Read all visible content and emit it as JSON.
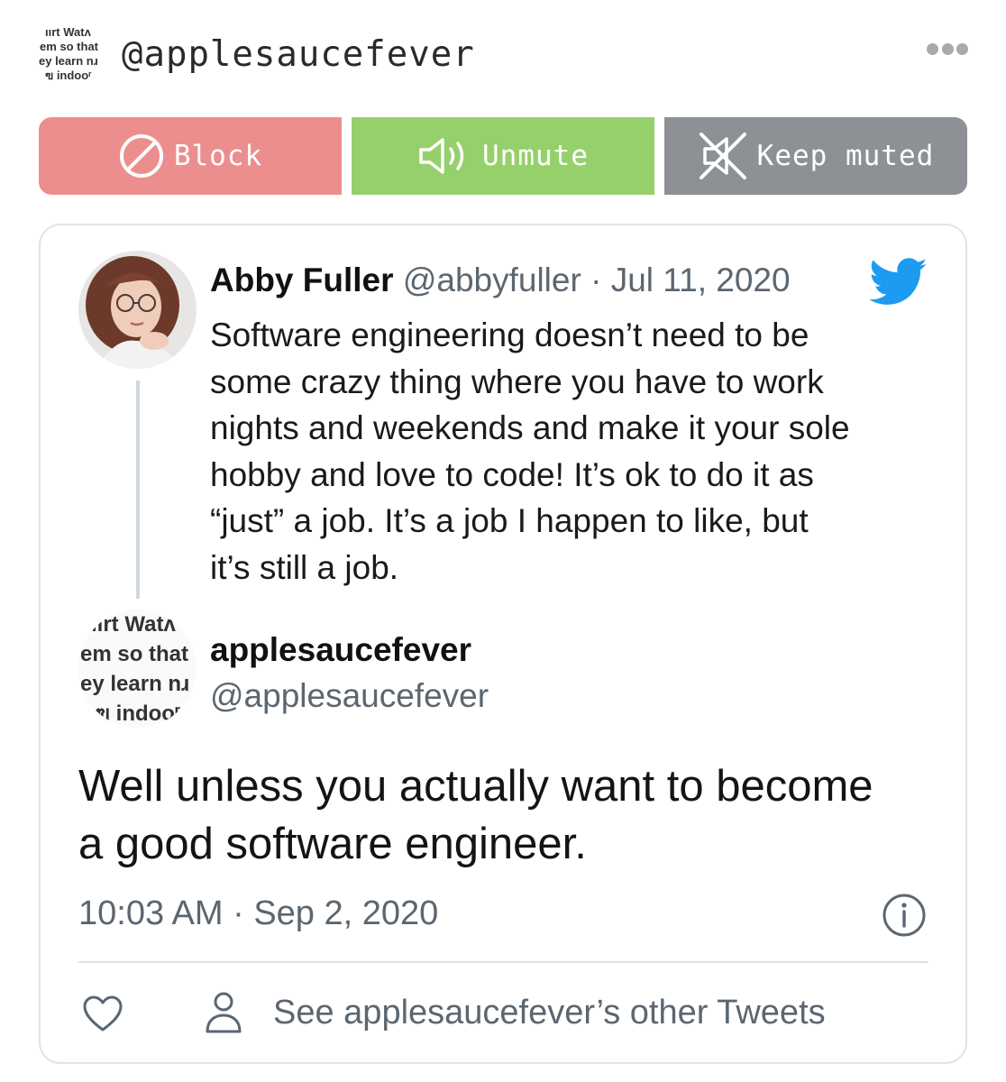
{
  "header": {
    "avatar_lines": [
      "ıırt Watʌ",
      "em so that",
      "ey learn nɹ",
      "ฃ indooʳ"
    ],
    "handle": "@applesaucefever"
  },
  "actions": {
    "block_label": "Block",
    "unmute_label": "Unmute",
    "keep_muted_label": "Keep muted",
    "colors": {
      "block": "#ec8e8e",
      "unmute": "#96d06b",
      "keep_muted": "#8d9196"
    }
  },
  "quoted_tweet": {
    "name": "Abby Fuller",
    "handle": "@abbyfuller",
    "separator": "·",
    "date": "Jul 11, 2020",
    "body_lines": [
      "Software engineering doesn’t need to be",
      "some crazy thing where you have to work",
      "nights and weekends and make it your sole",
      "hobby and love to code! It’s ok to do it as",
      "“just” a job. It’s a job I happen to like, but",
      "it’s still a job."
    ]
  },
  "reply_tweet": {
    "avatar_lines": [
      "ıırt Watʌ",
      "em so that",
      "ey learn nɹ",
      "ฃ indooʳ"
    ],
    "name": "applesaucefever",
    "handle": "@applesaucefever",
    "body_lines": [
      "Well unless you actually want to become",
      "a good software engineer."
    ],
    "timestamp": "10:03 AM · Sep 2, 2020"
  },
  "footer": {
    "see_other_tweets": "See applesaucefever’s other Tweets"
  },
  "icons": [
    "more-icon",
    "block-icon",
    "speaker-icon",
    "muted-speaker-icon",
    "twitter-bird-icon",
    "info-icon",
    "heart-icon",
    "person-icon"
  ],
  "accent_colors": {
    "twitter_blue": "#1d9bf0",
    "meta_gray": "#5b6670"
  }
}
